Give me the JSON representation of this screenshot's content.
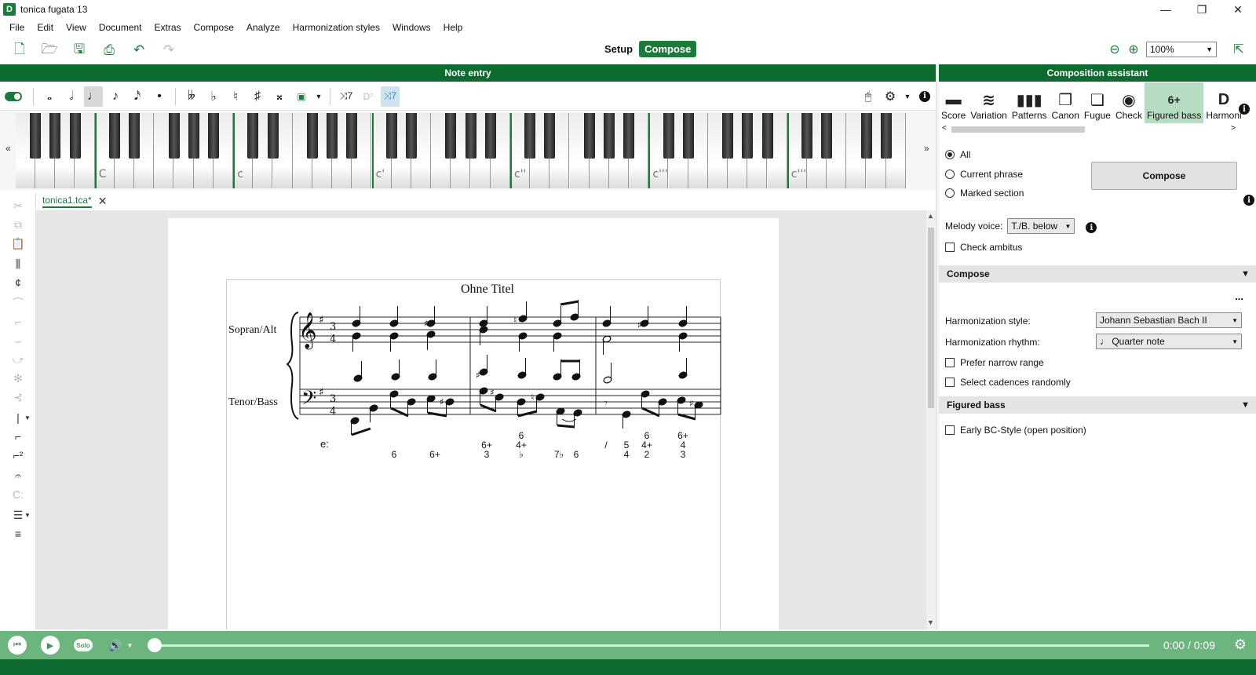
{
  "window": {
    "title": "tonica fugata 13",
    "app_icon_letter": "D"
  },
  "menu": [
    "File",
    "Edit",
    "View",
    "Document",
    "Extras",
    "Compose",
    "Analyze",
    "Harmonization styles",
    "Windows",
    "Help"
  ],
  "toolbar": {
    "mode_setup": "Setup",
    "mode_compose": "Compose",
    "zoom_value": "100%"
  },
  "panels": {
    "note_entry": "Note entry",
    "composition_assistant": "Composition assistant"
  },
  "keyboard": {
    "labels": [
      "C",
      "c",
      "c'",
      "c''",
      "c'''",
      "c''''"
    ]
  },
  "document": {
    "tab_name": "tonica1.tca*",
    "score_title": "Ohne Titel",
    "staves": [
      "Sopran/Alt",
      "Tenor/Bass"
    ],
    "key_label": "e:",
    "time_signature": [
      "3",
      "4"
    ],
    "figures": [
      {
        "top": "",
        "mid": "",
        "bot": "6"
      },
      {
        "top": "",
        "mid": "",
        "bot": "6+"
      },
      {
        "top": "",
        "mid": "6+",
        "bot": "3"
      },
      {
        "top": "6",
        "mid": "4+",
        "bot": "♭"
      },
      {
        "top": "",
        "mid": "",
        "bot": "7♭"
      },
      {
        "top": "",
        "mid": "",
        "bot": "6"
      },
      {
        "top": "",
        "mid": "/",
        "bot": ""
      },
      {
        "top": "",
        "mid": "5",
        "bot": "4"
      },
      {
        "top": "6",
        "mid": "4+",
        "bot": "2"
      },
      {
        "top": "6+",
        "mid": "4",
        "bot": "3"
      }
    ]
  },
  "assistant_tabs": [
    {
      "label": "Score",
      "icon": "score-icon",
      "glyph": "▬"
    },
    {
      "label": "Variation",
      "icon": "variation-icon",
      "glyph": "≋"
    },
    {
      "label": "Patterns",
      "icon": "patterns-icon",
      "glyph": "▮▮▮"
    },
    {
      "label": "Canon",
      "icon": "canon-icon",
      "glyph": "❐"
    },
    {
      "label": "Fugue",
      "icon": "fugue-icon",
      "glyph": "❏"
    },
    {
      "label": "Check",
      "icon": "check-icon",
      "glyph": "◉"
    },
    {
      "label": "Figured bass",
      "icon": "figured-bass-icon",
      "glyph": "6+"
    },
    {
      "label": "Harmoni",
      "icon": "harmonization-icon",
      "glyph": "D"
    }
  ],
  "assistant": {
    "scope_options": [
      "All",
      "Current phrase",
      "Marked section"
    ],
    "selected_scope": "All",
    "compose_button": "Compose",
    "melody_voice_label": "Melody voice:",
    "melody_voice_value": "T./B. below",
    "check_ambitus": "Check ambitus",
    "compose_section": "Compose",
    "more": "...",
    "harmonization_style_label": "Harmonization style:",
    "harmonization_style_value": "Johann Sebastian Bach II",
    "harmonization_rhythm_label": "Harmonization rhythm:",
    "harmonization_rhythm_value": "Quarter note",
    "prefer_narrow_range": "Prefer narrow range",
    "select_cadences_randomly": "Select cadences randomly",
    "figured_bass_section": "Figured bass",
    "early_bc_style": "Early BC-Style (open position)"
  },
  "player": {
    "solo_label": "Solo",
    "time": "0:00 / 0:09",
    "progress": 0.0
  },
  "colors": {
    "brand_green": "#0e6b30",
    "player_green": "#6cb57f",
    "active_tab": "#b6dcc2"
  }
}
